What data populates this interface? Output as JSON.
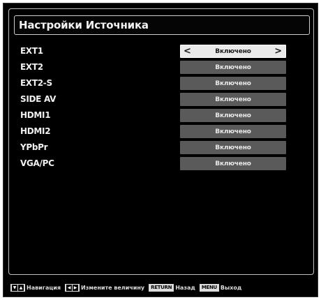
{
  "window": {
    "title": "Настройки Источника"
  },
  "sources": [
    {
      "label": "EXT1",
      "value": "Включено",
      "selected": true
    },
    {
      "label": "EXT2",
      "value": "Включено",
      "selected": false
    },
    {
      "label": "EXT2-S",
      "value": "Включено",
      "selected": false
    },
    {
      "label": "SIDE AV",
      "value": "Включено",
      "selected": false
    },
    {
      "label": "HDMI1",
      "value": "Включено",
      "selected": false
    },
    {
      "label": "HDMI2",
      "value": "Включено",
      "selected": false
    },
    {
      "label": "YPbPr",
      "value": "Включено",
      "selected": false
    },
    {
      "label": "VGA/PC",
      "value": "Включено",
      "selected": false
    }
  ],
  "selector": {
    "left_arrow": "<",
    "right_arrow": ">"
  },
  "footer": {
    "nav_keys": [
      "▼",
      "▲"
    ],
    "nav_label": "Навигация",
    "change_keys": [
      "◀",
      "▶"
    ],
    "change_label": "Измените величину",
    "back_key": "RETURN",
    "back_label": "Назад",
    "exit_key": "MENU",
    "exit_label": "Выход"
  },
  "icons": {
    "nav": "up-down-arrows-icon",
    "change": "left-right-arrows-icon"
  },
  "colors": {
    "background": "#000000",
    "selected_value_bg": "#eaeaea",
    "value_bg": "#5a5a5a",
    "text": "#f0f0f0"
  }
}
